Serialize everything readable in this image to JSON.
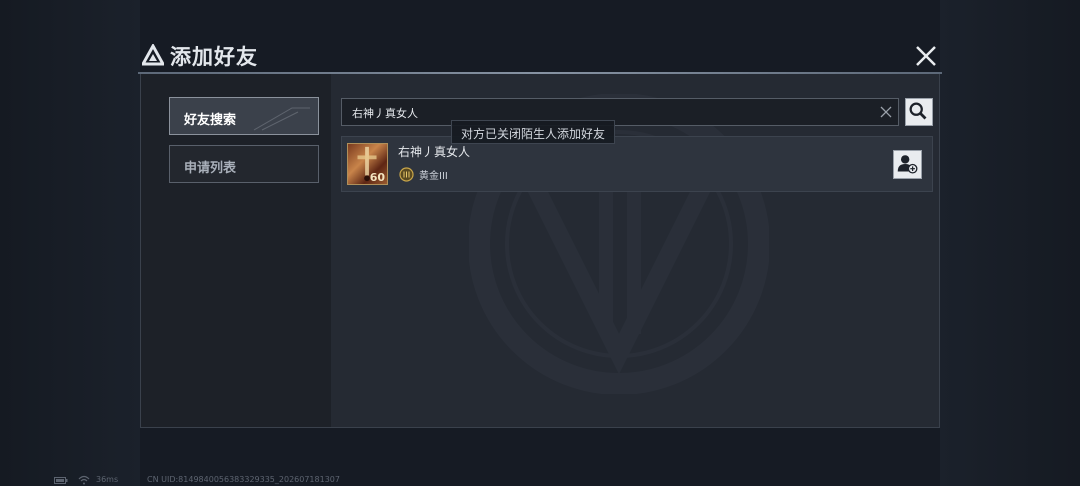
{
  "dialog": {
    "title": "添加好友"
  },
  "sidebar": {
    "tabs": [
      {
        "label": "好友搜索",
        "active": true
      },
      {
        "label": "申请列表",
        "active": false
      }
    ]
  },
  "search": {
    "value": "右神丿真女人"
  },
  "results": [
    {
      "name": "右神丿真女人",
      "level": "60",
      "rank": "黄金III",
      "rank_icon": "gold-rank-icon",
      "action_icon": "add-friend-icon"
    }
  ],
  "toast": {
    "message": "对方已关闭陌生人添加好友"
  },
  "status_bar": {
    "ping": "36ms",
    "uid": "CN UID:8149840056383329335_202607181307"
  },
  "colors": {
    "accent": "#8b929c",
    "panel": "#22272f",
    "background": "#161b24"
  }
}
